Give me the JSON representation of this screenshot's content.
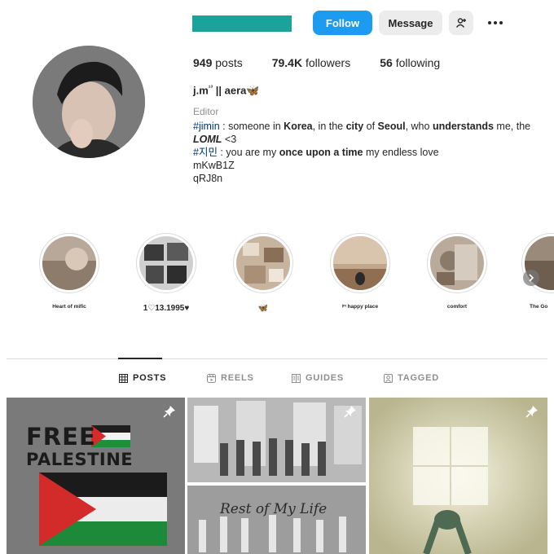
{
  "header": {
    "follow_label": "Follow",
    "message_label": "Message",
    "add_user_icon": "person-plus-icon",
    "more_icon": "ellipsis-icon",
    "username_color": "#1aa39a"
  },
  "stats": {
    "posts_count": "949",
    "posts_label": "posts",
    "followers_count": "79.4K",
    "followers_label": "followers",
    "following_count": "56",
    "following_label": "following"
  },
  "profile": {
    "display_name_prefix": "j.m",
    "display_name_sup": "¹³",
    "display_name_suffix": " || aera",
    "display_name_emoji": "🦋",
    "category": "Editor",
    "bio": {
      "line1_tag": "#jimin",
      "line1_a": " : someone in ",
      "line1_b": "Korea",
      "line1_c": ", in the ",
      "line1_d": "city",
      "line1_e": " of ",
      "line1_f": "Seoul",
      "line1_g": ", who ",
      "line1_h": "understands",
      "line1_i": " me, the",
      "line2_b": "LOML",
      "line2_a": " <3",
      "line3_tag": "#지민",
      "line3_a": " : you are my ",
      "line3_b": "once upon a time",
      "line3_c": " my endless love",
      "line4": "mKwB1Z",
      "line5": "qRJ8n"
    }
  },
  "highlights": [
    {
      "label": "Heart of mific"
    },
    {
      "label": "1♡13.1995♥"
    },
    {
      "label": "🦋"
    },
    {
      "label": "ʲᵐ  happy place"
    },
    {
      "label": "comfort"
    },
    {
      "label": "The Go"
    }
  ],
  "tabs": [
    {
      "label": "POSTS",
      "icon": "grid-icon"
    },
    {
      "label": "REELS",
      "icon": "reels-icon"
    },
    {
      "label": "GUIDES",
      "icon": "guides-icon"
    },
    {
      "label": "TAGGED",
      "icon": "tagged-icon"
    }
  ],
  "posts": [
    {
      "line1": "FREE",
      "line2": "PALESTINE",
      "pinned": true
    },
    {
      "caption": "Rest of My Life",
      "pinned": true
    },
    {
      "pinned": true
    }
  ]
}
